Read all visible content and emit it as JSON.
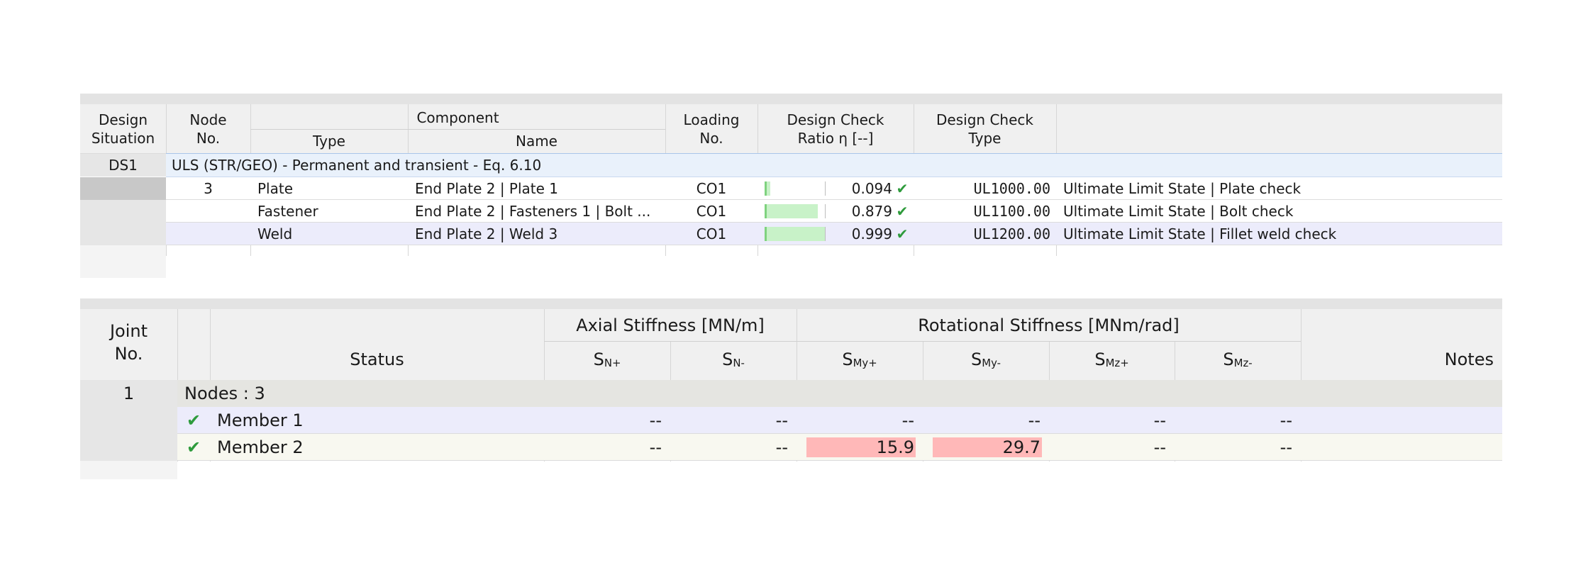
{
  "design_table": {
    "headers": {
      "design_situation": [
        "Design",
        "Situation"
      ],
      "node_no": [
        "Node",
        "No."
      ],
      "component": "Component",
      "type": "Type",
      "name": "Name",
      "loading_no": [
        "Loading",
        "No."
      ],
      "design_check_ratio": [
        "Design Check",
        "Ratio η [--]"
      ],
      "design_check_type": [
        "Design Check",
        "Type"
      ]
    },
    "situation": {
      "id": "DS1",
      "description": "ULS (STR/GEO) - Permanent and transient - Eq. 6.10"
    },
    "rows": [
      {
        "node": "3",
        "type": "Plate",
        "name": "End Plate 2 | Plate 1",
        "loading": "CO1",
        "ratio": 0.094,
        "ratio_text": "0.094",
        "code": "UL1000.00",
        "description": "Ultimate Limit State | Plate check"
      },
      {
        "node": "",
        "type": "Fastener",
        "name": "End Plate 2 | Fasteners 1 | Bolt ...",
        "loading": "CO1",
        "ratio": 0.879,
        "ratio_text": "0.879",
        "code": "UL1100.00",
        "description": "Ultimate Limit State | Bolt check"
      },
      {
        "node": "",
        "type": "Weld",
        "name": "End Plate 2 | Weld 3",
        "loading": "CO1",
        "ratio": 0.999,
        "ratio_text": "0.999",
        "code": "UL1200.00",
        "description": "Ultimate Limit State | Fillet weld check"
      }
    ],
    "colors": {
      "ratio_bar": "#c8f2c8",
      "selected_row": "#ececfb",
      "situation_row": "#e9f1fb",
      "check": "#2e9b3c"
    }
  },
  "stiffness_table": {
    "headers": {
      "joint_no": [
        "Joint",
        "No."
      ],
      "status": "Status",
      "axial_group": "Axial Stiffness [MN/m]",
      "rotational_group": "Rotational Stiffness [MNm/rad]",
      "notes": "Notes",
      "columns": [
        {
          "main": "S",
          "sub": "N+"
        },
        {
          "main": "S",
          "sub": "N-"
        },
        {
          "main": "S",
          "sub": "My+"
        },
        {
          "main": "S",
          "sub": "My-"
        },
        {
          "main": "S",
          "sub": "Mz+"
        },
        {
          "main": "S",
          "sub": "Mz-"
        }
      ]
    },
    "joint": {
      "id": "1",
      "nodes_label": "Nodes : 3"
    },
    "rows": [
      {
        "member": "Member 1",
        "values": [
          "--",
          "--",
          "--",
          "--",
          "--",
          "--"
        ]
      },
      {
        "member": "Member 2",
        "values": [
          "--",
          "--",
          "15.9",
          "29.7",
          "--",
          "--"
        ]
      }
    ],
    "colors": {
      "highlight": "#ffb8b8",
      "group_row": "#e5e5e1",
      "row1": "#ececfb",
      "row2": "#f8f8f0",
      "check": "#2e9b3c"
    }
  }
}
